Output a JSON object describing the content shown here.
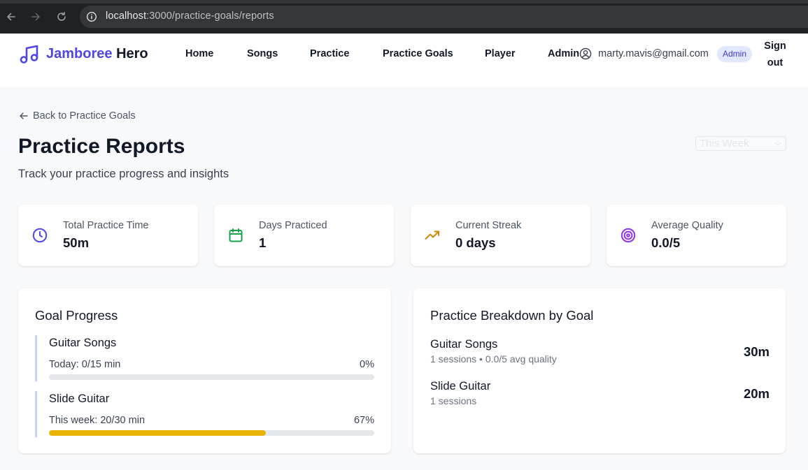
{
  "browser": {
    "url_host": "localhost",
    "url_path": ":3000/practice-goals/reports"
  },
  "header": {
    "brand_primary": "Jamboree",
    "brand_secondary": "Hero",
    "nav": [
      "Home",
      "Songs",
      "Practice",
      "Practice Goals",
      "Player",
      "Admin"
    ],
    "user_email": "marty.mavis@gmail.com",
    "role_badge": "Admin",
    "signout_line1": "Sign",
    "signout_line2": "out"
  },
  "page": {
    "back_link": "Back to Practice Goals",
    "title": "Practice Reports",
    "subtitle": "Track your practice progress and insights",
    "range_select": "This Week"
  },
  "stats": [
    {
      "label": "Total Practice Time",
      "value": "50m",
      "icon": "clock-icon",
      "color": "#4f46e5"
    },
    {
      "label": "Days Practiced",
      "value": "1",
      "icon": "calendar-icon",
      "color": "#16a34a"
    },
    {
      "label": "Current Streak",
      "value": "0 days",
      "icon": "trending-up-icon",
      "color": "#ca8a04"
    },
    {
      "label": "Average Quality",
      "value": "0.0/5",
      "icon": "target-icon",
      "color": "#9333ea"
    }
  ],
  "goal_progress": {
    "title": "Goal Progress",
    "goals": [
      {
        "name": "Guitar Songs",
        "status": "Today: 0/15 min",
        "percent_label": "0%",
        "progress": 0.0
      },
      {
        "name": "Slide Guitar",
        "status": "This week: 20/30 min",
        "percent_label": "67%",
        "progress": 0.667
      }
    ]
  },
  "breakdown": {
    "title": "Practice Breakdown by Goal",
    "rows": [
      {
        "name": "Guitar Songs",
        "detail": "1 sessions • 0.0/5 avg quality",
        "time": "30m"
      },
      {
        "name": "Slide Guitar",
        "detail": "1 sessions",
        "time": "20m"
      }
    ]
  },
  "colors": {
    "accent": "#4f46e5",
    "progress_fill": "#eab308",
    "progress_track": "#e5e7eb",
    "goal_border": "#c7d2fe"
  }
}
